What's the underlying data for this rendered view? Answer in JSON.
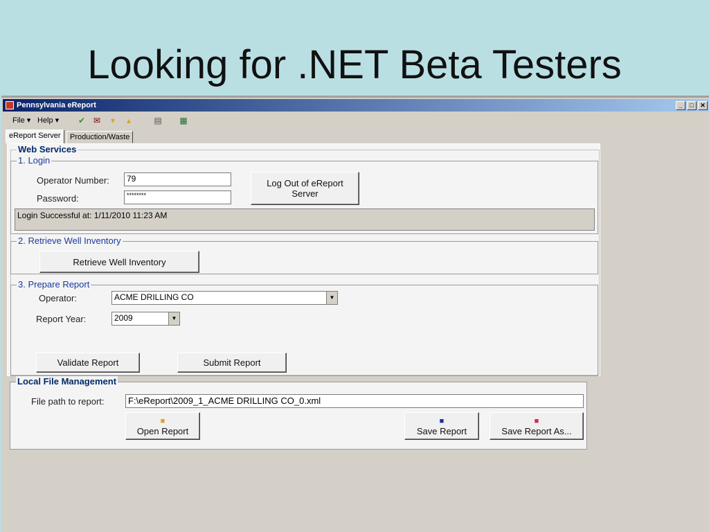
{
  "slide": {
    "title": "Looking for .NET Beta Testers"
  },
  "window": {
    "title": "Pennsylvania eReport",
    "minimize": "_",
    "maximize": "□",
    "close": "✕"
  },
  "menu": {
    "file": "File ▾",
    "help": "Help ▾"
  },
  "toolbar_icons": [
    "check-icon",
    "mail-icon",
    "folder-down-icon",
    "folder-up-icon",
    "document-icon",
    "excel-icon"
  ],
  "tabs": [
    "eReport Server",
    "Production/Waste"
  ],
  "web_services": {
    "legend": "Web Services",
    "login": {
      "legend": "1. Login",
      "operator_label": "Operator Number:",
      "operator_value": "79",
      "password_label": "Password:",
      "password_value": "********",
      "logout_button": "Log Out of eReport Server",
      "status": "Login Successful at: 1/11/2010 11:23 AM"
    },
    "retrieve": {
      "legend": "2. Retrieve Well Inventory",
      "button": "Retrieve Well Inventory"
    },
    "prepare": {
      "legend": "3. Prepare Report",
      "operator_label": "Operator:",
      "operator_value": "ACME DRILLING CO",
      "year_label": "Report Year:",
      "year_value": "2009",
      "validate_button": "Validate Report",
      "submit_button": "Submit Report"
    }
  },
  "local_files": {
    "legend": "Local File Management",
    "path_label": "File path to report:",
    "path_value": "F:\\eReport\\2009_1_ACME DRILLING CO_0.xml",
    "open_button": "Open Report",
    "save_button": "Save Report",
    "save_as_button": "Save Report As..."
  }
}
